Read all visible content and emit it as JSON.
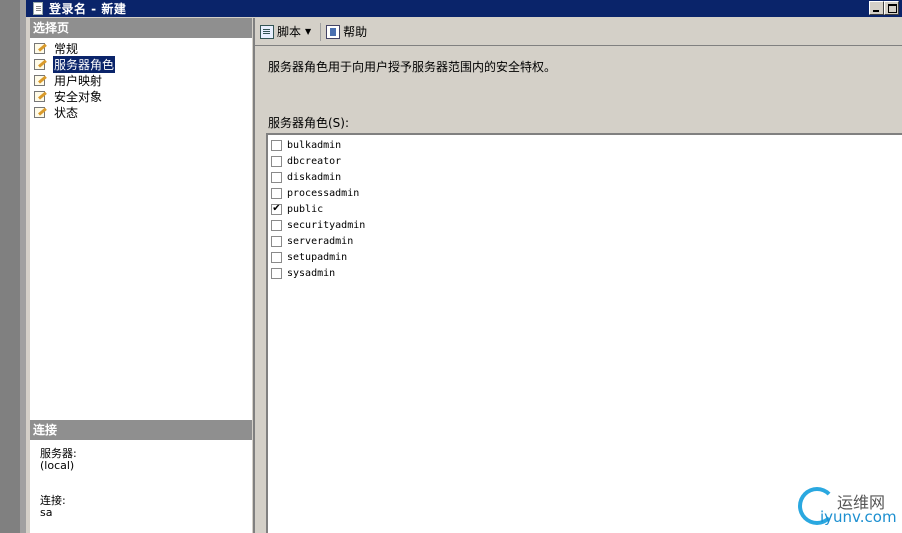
{
  "window": {
    "title": "登录名 - 新建"
  },
  "left_panel": {
    "pages_header": "选择页",
    "pages": [
      {
        "label": "常规",
        "selected": false
      },
      {
        "label": "服务器角色",
        "selected": true
      },
      {
        "label": "用户映射",
        "selected": false
      },
      {
        "label": "安全对象",
        "selected": false
      },
      {
        "label": "状态",
        "selected": false
      }
    ],
    "connection_header": "连接",
    "server_label": "服务器:",
    "server_value": "(local)",
    "connection_label": "连接:",
    "connection_value": "sa"
  },
  "toolbar": {
    "script_label": "脚本",
    "help_label": "帮助"
  },
  "main": {
    "description": "服务器角色用于向用户授予服务器范围内的安全特权。",
    "roles_label": "服务器角色(S):",
    "roles": [
      {
        "name": "bulkadmin",
        "checked": false
      },
      {
        "name": "dbcreator",
        "checked": false
      },
      {
        "name": "diskadmin",
        "checked": false
      },
      {
        "name": "processadmin",
        "checked": false
      },
      {
        "name": "public",
        "checked": true
      },
      {
        "name": "securityadmin",
        "checked": false
      },
      {
        "name": "serveradmin",
        "checked": false
      },
      {
        "name": "setupadmin",
        "checked": false
      },
      {
        "name": "sysadmin",
        "checked": false
      }
    ]
  },
  "watermark": {
    "cn": "运维网",
    "en": "iyunv.com"
  }
}
